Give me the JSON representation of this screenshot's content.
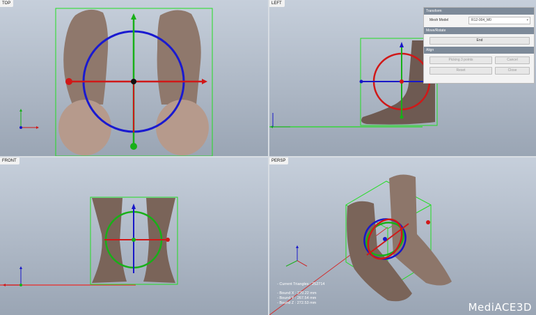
{
  "viewports": {
    "top": {
      "label": "TOP"
    },
    "left": {
      "label": "LEFT"
    },
    "front": {
      "label": "FRONT"
    },
    "persp": {
      "label": "PERSP"
    }
  },
  "panel": {
    "transform_title": "Transform",
    "mesh_model_label": "Mesh Model",
    "mesh_model_value": "R12-004_M0",
    "move_rotate_title": "Move/Rotate",
    "end_button": "End",
    "align_title": "Align",
    "picking_button": "Picking 3 points",
    "cancel_button": "Cancel",
    "reset_button": "Reset",
    "close_button": "Close"
  },
  "stats": {
    "triangles": "- Current Triangles : 252714",
    "bound_x": "- Bound X : 270.22 mm",
    "bound_y": "- Bound Y : 267.54 mm",
    "bound_z": "- Bound Z : 272.53 mm"
  },
  "logo": {
    "text": "MediACE3D"
  },
  "colors": {
    "x_axis": "#d01818",
    "y_axis": "#18b018",
    "z_axis": "#1818c8",
    "bbox": "#22dd22"
  }
}
